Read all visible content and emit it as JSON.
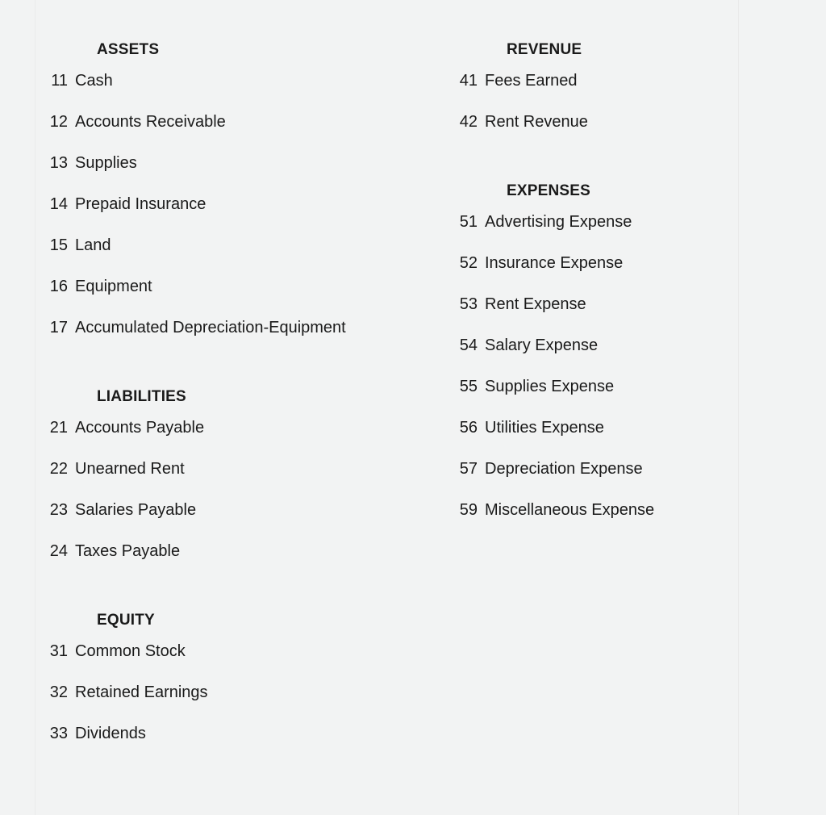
{
  "document": {
    "background_color": "#f2f3f3",
    "text_color": "#1a1a1a",
    "rule_color": "#eaeaea"
  },
  "columns": [
    {
      "id": "left",
      "sections": [
        {
          "header": "ASSETS",
          "accounts": [
            {
              "number": "11",
              "name": "Cash"
            },
            {
              "number": "12",
              "name": "Accounts Receivable"
            },
            {
              "number": "13",
              "name": "Supplies"
            },
            {
              "number": "14",
              "name": "Prepaid Insurance"
            },
            {
              "number": "15",
              "name": "Land"
            },
            {
              "number": "16",
              "name": "Equipment"
            },
            {
              "number": "17",
              "name": "Accumulated Depreciation-Equipment"
            }
          ]
        },
        {
          "header": "LIABILITIES",
          "accounts": [
            {
              "number": "21",
              "name": "Accounts Payable"
            },
            {
              "number": "22",
              "name": "Unearned Rent"
            },
            {
              "number": "23",
              "name": "Salaries Payable"
            },
            {
              "number": "24",
              "name": "Taxes Payable"
            }
          ]
        },
        {
          "header": "EQUITY",
          "accounts": [
            {
              "number": "31",
              "name": "Common Stock"
            },
            {
              "number": "32",
              "name": "Retained Earnings"
            },
            {
              "number": "33",
              "name": "Dividends"
            }
          ]
        }
      ]
    },
    {
      "id": "right",
      "sections": [
        {
          "header": "REVENUE",
          "accounts": [
            {
              "number": "41",
              "name": "Fees Earned"
            },
            {
              "number": "42",
              "name": "Rent Revenue"
            }
          ]
        },
        {
          "header": "EXPENSES",
          "accounts": [
            {
              "number": "51",
              "name": "Advertising Expense"
            },
            {
              "number": "52",
              "name": "Insurance Expense"
            },
            {
              "number": "53",
              "name": "Rent Expense"
            },
            {
              "number": "54",
              "name": "Salary Expense"
            },
            {
              "number": "55",
              "name": "Supplies Expense"
            },
            {
              "number": "56",
              "name": "Utilities Expense"
            },
            {
              "number": "57",
              "name": "Depreciation Expense"
            },
            {
              "number": "59",
              "name": "Miscellaneous Expense"
            }
          ]
        }
      ]
    }
  ]
}
